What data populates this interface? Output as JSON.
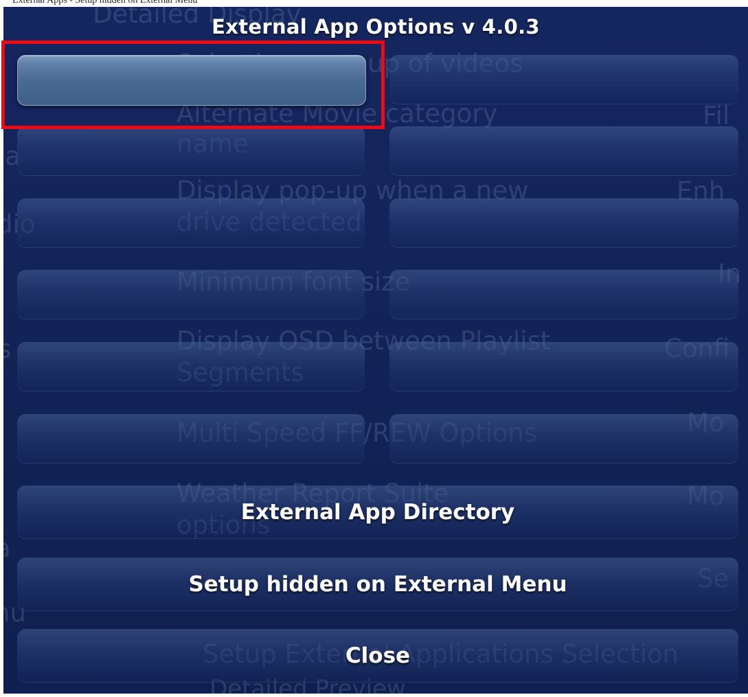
{
  "window": {
    "title": "External App Options v 4.0.3",
    "top_strip_text": "External Apps - Setup hidden on External Menu"
  },
  "background": {
    "lines": [
      "Detailed Display",
      "Selecting a group of videos",
      "Alternate Movie category",
      "name",
      "Display pop-up when a new",
      "drive detected",
      "Minimum font size",
      "Display OSD between Playlist",
      "Segments",
      "Multi Speed FF/REW Options",
      "Weather Report Suite",
      "options",
      "Setup External Applications Selection",
      "Detailed Preview",
      "Fil",
      "Enh",
      "In",
      "Confi",
      "Mo",
      "Mo",
      "Se",
      "ia",
      "dio",
      "s",
      "a",
      "nu"
    ]
  },
  "options": [
    {
      "label": "",
      "selected": true
    },
    {
      "label": "",
      "selected": false
    },
    {
      "label": "",
      "selected": false
    },
    {
      "label": "",
      "selected": false
    },
    {
      "label": "",
      "selected": false
    },
    {
      "label": "",
      "selected": false
    },
    {
      "label": "",
      "selected": false
    },
    {
      "label": "",
      "selected": false
    },
    {
      "label": "",
      "selected": false
    },
    {
      "label": "",
      "selected": false
    },
    {
      "label": "",
      "selected": false
    },
    {
      "label": "",
      "selected": false
    }
  ],
  "actions": {
    "directory": "External App Directory",
    "setup_hidden": "Setup hidden on External Menu",
    "close": "Close"
  },
  "colors": {
    "dialog_bg": "#13255c",
    "selected_button": "#5f7fa8",
    "highlight_box": "#ee0a12",
    "text": "#ffffff"
  }
}
